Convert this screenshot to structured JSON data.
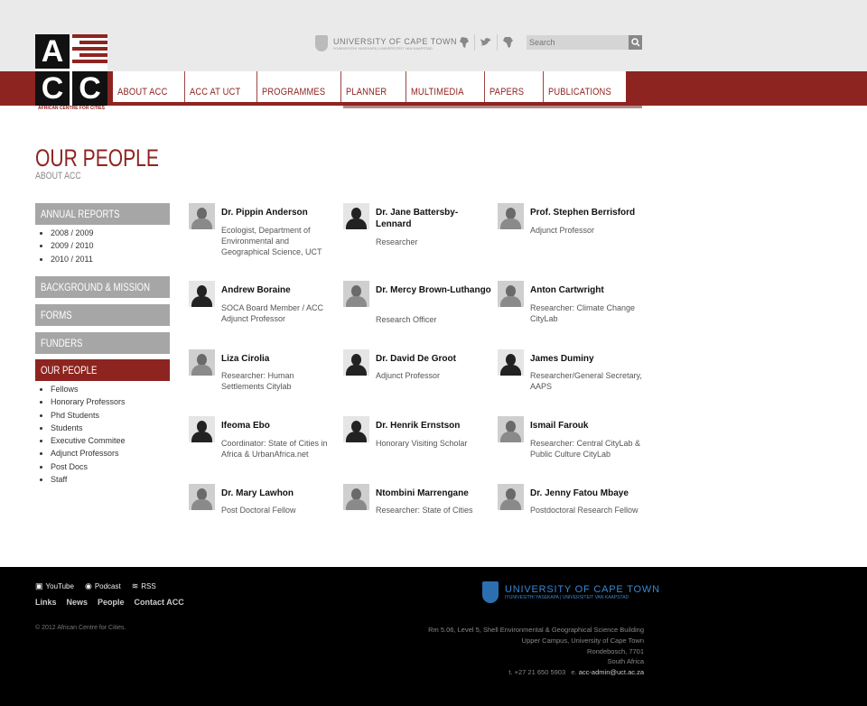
{
  "header": {
    "logo_letters": [
      "A",
      "C",
      "C"
    ],
    "logo_tagline": "AFRICAN CENTRE FOR CITIES",
    "uct_name": "UNIVERSITY OF CAPE TOWN",
    "uct_subtitle": "IYUNIVESITHI YASEKAPA | UNIVERSITEIT VAN KAAPSTAD",
    "search_placeholder": "Search",
    "icons": [
      "africa-map-icon",
      "twitter-bird-icon",
      "africa-icon"
    ]
  },
  "nav": [
    "ABOUT ACC",
    "ACC AT UCT",
    "PROGRAMMES",
    "PLANNER",
    "MULTIMEDIA",
    "PAPERS",
    "PUBLICATIONS"
  ],
  "page": {
    "title": "OUR PEOPLE",
    "subtitle": "ABOUT ACC"
  },
  "sidebar": {
    "annual_reports": "ANNUAL REPORTS",
    "reports": [
      "2008 / 2009",
      "2009 / 2010",
      "2010 / 2011"
    ],
    "background": "BACKGROUND & MISSION",
    "forms": "FORMS",
    "funders": "FUNDERS",
    "our_people": "OUR PEOPLE",
    "people_links": [
      "Fellows",
      "Honorary Professors",
      "Phd Students",
      "Students",
      "Executive Commitee",
      "Adjunct Professors",
      "Post Docs",
      "Staff"
    ]
  },
  "people": [
    {
      "name": "Dr. Pippin Anderson",
      "role": "Ecologist, Department of Environmental and Geographical Science, UCT"
    },
    {
      "name": "Dr. Jane Battersby-Lennard",
      "role": "Researcher"
    },
    {
      "name": "Prof. Stephen Berrisford",
      "role": "Adjunct Professor"
    },
    {
      "name": "Andrew Boraine",
      "role": "SOCA Board Member / ACC Adjunct Professor"
    },
    {
      "name": "Dr. Mercy Brown-Luthango",
      "role": "Research Officer"
    },
    {
      "name": "Anton Cartwright",
      "role": "Researcher: Climate Change CityLab"
    },
    {
      "name": "Liza Cirolia",
      "role": "Researcher: Human Settlements Citylab"
    },
    {
      "name": "Dr. David De Groot",
      "role": "Adjunct Professor"
    },
    {
      "name": "James Duminy",
      "role": "Researcher/General Secretary, AAPS"
    },
    {
      "name": "Ifeoma Ebo",
      "role": "Coordinator: State of Cities in Africa & UrbanAfrica.net"
    },
    {
      "name": "Dr. Henrik Ernstson",
      "role": "Honorary Visiting Scholar"
    },
    {
      "name": "Ismail Farouk",
      "role": "Researcher: Central CityLab & Public Culture CityLab"
    },
    {
      "name": "Dr. Mary Lawhon",
      "role": "Post Doctoral Fellow"
    },
    {
      "name": "Ntombini Marrengane",
      "role": "Researcher: State of Cities"
    },
    {
      "name": "Dr. Jenny Fatou Mbaye",
      "role": "Postdoctoral Research Fellow"
    }
  ],
  "footer": {
    "social": [
      "YouTube",
      "Podcast",
      "RSS"
    ],
    "links": [
      "Links",
      "News",
      "People",
      "Contact ACC"
    ],
    "copyright": "© 2012 African Centre for Cities.",
    "uct_name": "UNIVERSITY OF CAPE TOWN",
    "uct_subtitle": "IYUNIVESITHI YASEKAPA | UNIVERSITEIT VAN KAAPSTAD",
    "address": [
      "Rm 5.06, Level 5, Shell Environmental & Geographical Science Building",
      "Upper Campus, University of Cape Town",
      "Rondebosch, 7701",
      "South Africa"
    ],
    "phone": "t. +27 21 650 5903",
    "email_prefix": "e.",
    "email": "acc-admin@uct.ac.za"
  }
}
